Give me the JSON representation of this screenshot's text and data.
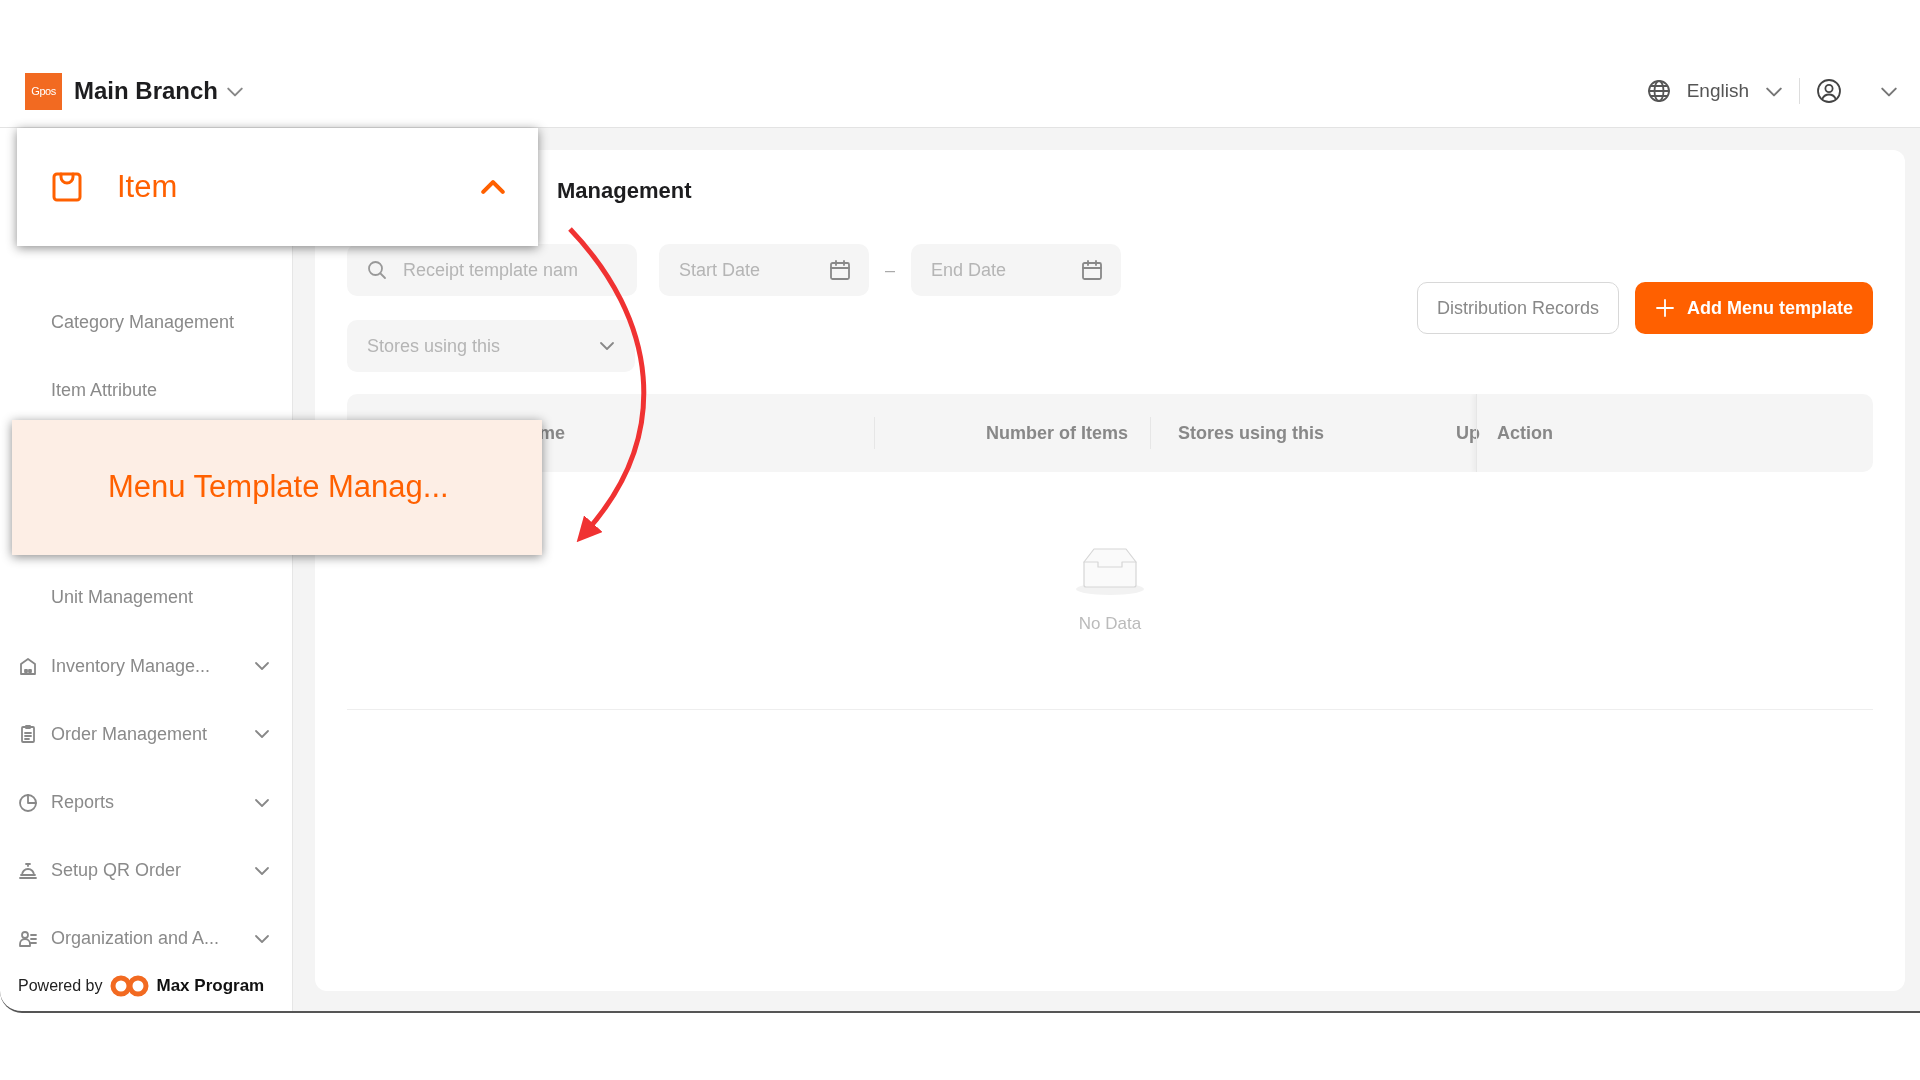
{
  "header": {
    "logo": "Gpos",
    "branch": "Main Branch",
    "language": "English"
  },
  "sidebar": {
    "items": [
      {
        "label": "Category Management",
        "kind": "sub"
      },
      {
        "label": "Item Attribute",
        "kind": "sub"
      },
      {
        "label": "Unit Management",
        "kind": "sub"
      },
      {
        "label": "Inventory Manage...",
        "kind": "group",
        "expanded": false
      },
      {
        "label": "Order Management",
        "kind": "group",
        "expanded": false
      },
      {
        "label": "Reports",
        "kind": "group",
        "expanded": false
      },
      {
        "label": "Setup QR Order",
        "kind": "group",
        "expanded": false
      },
      {
        "label": "Organization and A...",
        "kind": "group",
        "expanded": false
      }
    ],
    "footer": {
      "prefix": "Powered by",
      "brand": "Max Program"
    }
  },
  "page": {
    "title": "Management",
    "search": {
      "placeholder": "Receipt template nam"
    },
    "start_date": {
      "placeholder": "Start Date"
    },
    "end_date": {
      "placeholder": "End Date"
    },
    "date_separator": "–",
    "store_filter": {
      "placeholder": "Stores using this"
    },
    "buttons": [
      {
        "label": "Distribution Records",
        "kind": "outline"
      },
      {
        "label": "Add Menu template",
        "kind": "primary"
      }
    ],
    "table": {
      "columns": [
        {
          "label": "me"
        },
        {
          "label": "Number of Items"
        },
        {
          "label": "Stores using this"
        },
        {
          "label": "Up"
        },
        {
          "label": "Action"
        }
      ],
      "empty_text": "No Data"
    }
  },
  "callouts": [
    {
      "label": "Item",
      "kind": "group",
      "expanded": true
    },
    {
      "label": "Menu Template Manag...",
      "kind": "item",
      "selected": true
    }
  ]
}
